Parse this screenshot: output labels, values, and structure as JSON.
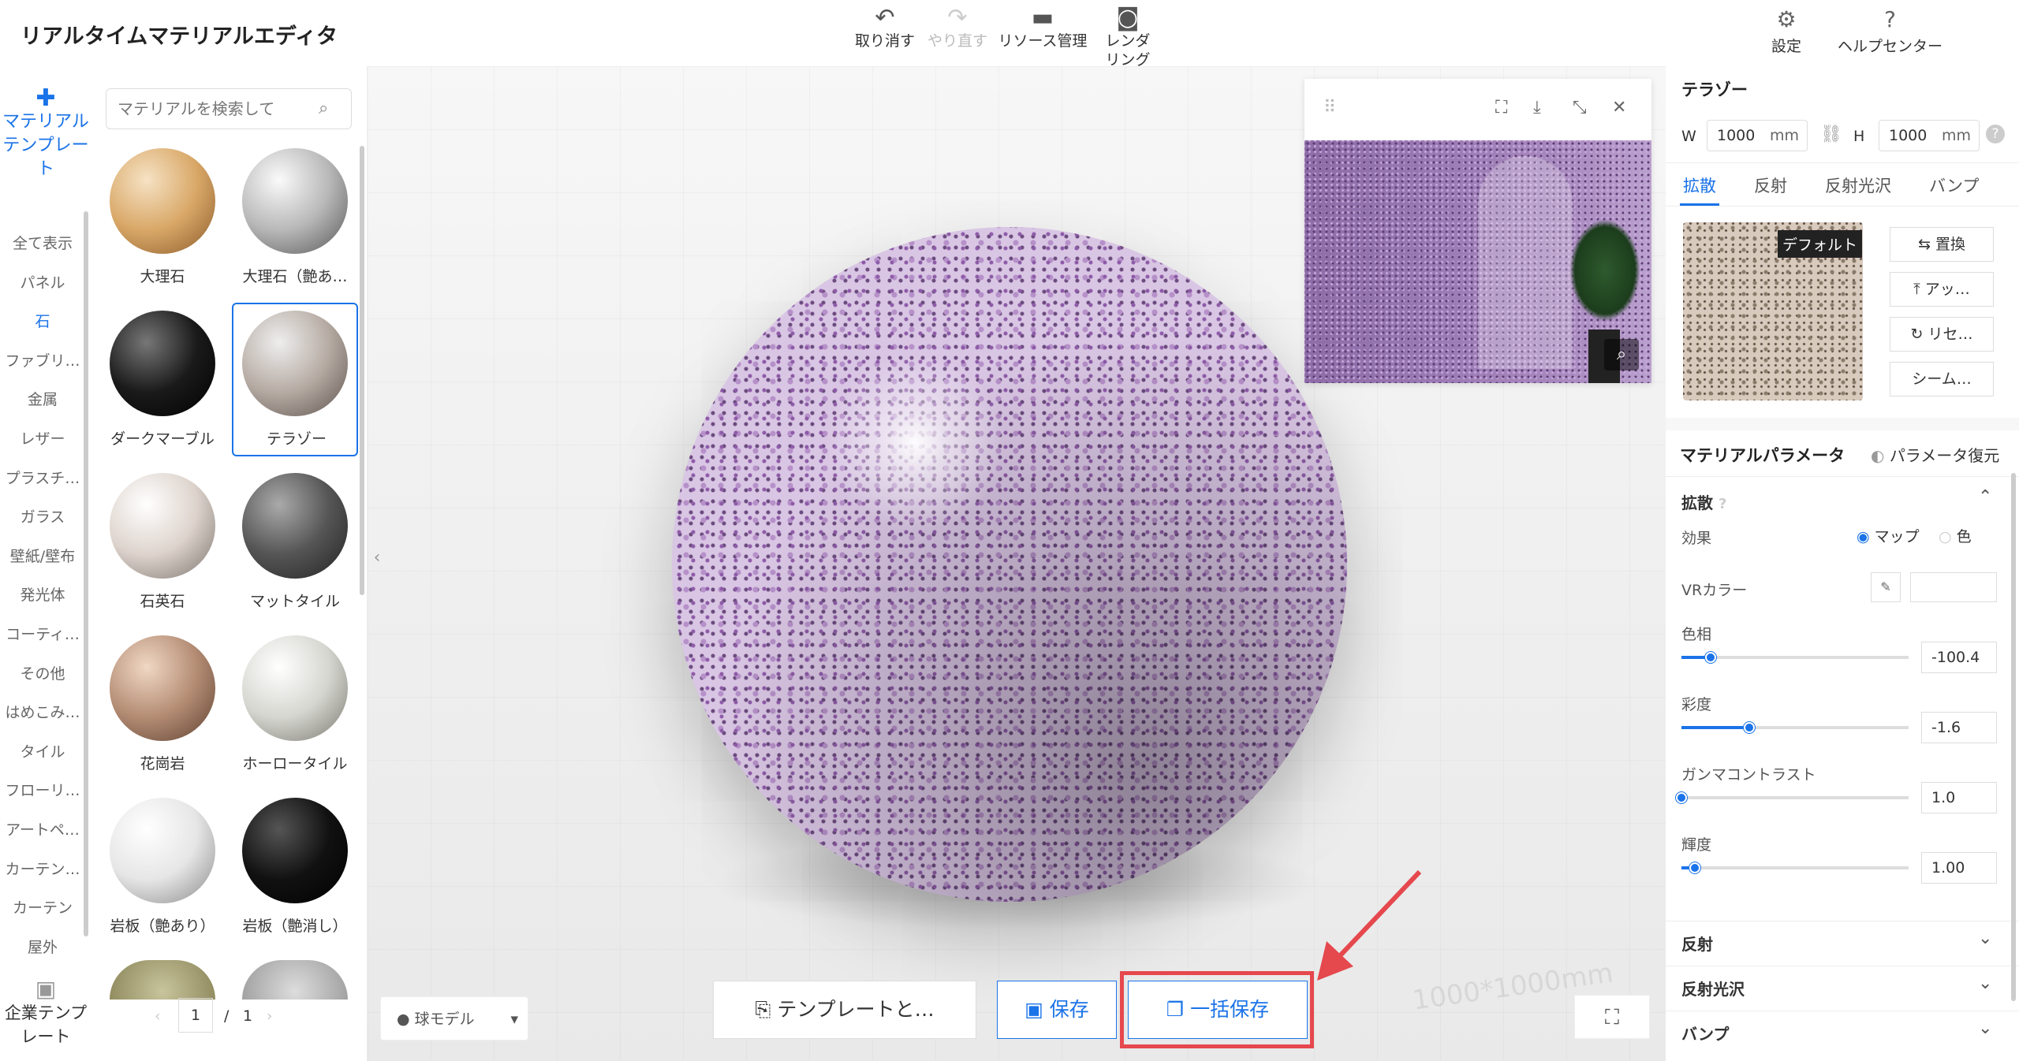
{
  "app": {
    "title": "リアルタイムマテリアルエディタ"
  },
  "toolbar": {
    "undo": "取り消す",
    "redo": "やり直す",
    "resources": "リソース管理",
    "render": "レンダ\nリング",
    "settings": "設定",
    "help": "ヘルプセンター"
  },
  "leftnav": {
    "material_template": "マテリアル\nテンプレー\nト",
    "enterprise_template": "企業テンプ\nレート",
    "categories": [
      "全て表示",
      "パネル",
      "石",
      "ファブリ…",
      "金属",
      "レザー",
      "プラスチ…",
      "ガラス",
      "壁紙/壁布",
      "発光体",
      "コーティ…",
      "その他",
      "はめこみ…",
      "タイル",
      "フローリ…",
      "アートペ…",
      "カーテン…",
      "カーテン",
      "屋外"
    ],
    "active_index": 2
  },
  "library": {
    "search_placeholder": "マテリアルを検索して",
    "items": [
      "大理石",
      "大理石（艶あ…",
      "ダークマーブル",
      "テラゾー",
      "石英石",
      "マットタイル",
      "花崗岩",
      "ホーロータイル",
      "岩板（艶あり）",
      "岩板（艶消し）"
    ],
    "selected_index": 3,
    "page": "1",
    "page_sep": "/",
    "page_total": "1"
  },
  "viewport": {
    "model_select": "球モデル",
    "watermark": "1000*1000mm",
    "btn_template": "テンプレートと…",
    "btn_save": "保存",
    "btn_batch_save": "一括保存"
  },
  "right": {
    "material_name": "テラゾー",
    "w_label": "W",
    "w_value": "1000",
    "h_label": "H",
    "h_value": "1000",
    "unit": "mm",
    "tabs": [
      "拡散",
      "反射",
      "反射光沢",
      "バンプ"
    ],
    "default_badge": "デフォルト",
    "actions": [
      "置換",
      "アッ…",
      "リセ…",
      "シーム…"
    ],
    "params_title": "マテリアルパラメータ",
    "restore": "パラメータ復元",
    "diffuse": "拡散",
    "effect": "効果",
    "opt_map": "マップ",
    "opt_color": "色",
    "vr_color": "VRカラー",
    "sliders": [
      {
        "label": "色相",
        "value": "-100.4",
        "pct": 0.13
      },
      {
        "label": "彩度",
        "value": "-1.6",
        "pct": 0.3
      },
      {
        "label": "ガンマコントラスト",
        "value": "1.0",
        "pct": 0.0
      },
      {
        "label": "輝度",
        "value": "1.00",
        "pct": 0.06
      }
    ],
    "sections": [
      "反射",
      "反射光沢",
      "バンプ"
    ]
  },
  "colors": {
    "accent": "#1a73e8",
    "highlight": "#e5484d"
  }
}
